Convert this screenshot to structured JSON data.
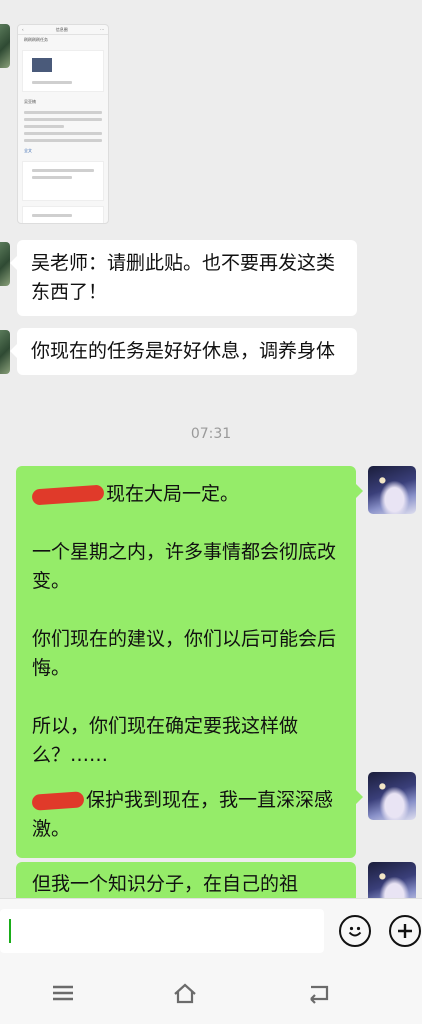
{
  "top_title": "",
  "screenshot_preview": {
    "header": "信息圈",
    "lines": [
      "刷刷刷刷任务",
      "吴亚楠",
      "全文"
    ]
  },
  "messages": {
    "m1": "吴老师：请删此贴。也不要再发这类东西了！",
    "m2": "你现在的任务是好好休息，调养身体",
    "timestamp": "07:31",
    "m3_p1": "现在大局一定。",
    "m3_p2": "一个星期之内，许多事情都会彻底改变。",
    "m3_p3": "你们现在的建议，你们以后可能会后悔。",
    "m3_p4": "所以，你们现在确定要我这样做么？……",
    "m4": "保护我到现在，我一直深深感激。",
    "m5": "但我一个知识分子，在自己的祖"
  },
  "composer": {
    "input_value": ""
  },
  "icons": {
    "emoji": "emoji-icon",
    "plus": "plus-icon",
    "menu": "menu-icon",
    "home": "home-icon",
    "back": "back-icon"
  },
  "colors": {
    "self_bubble": "#95ec69",
    "other_bubble": "#ffffff",
    "background": "#ededed"
  }
}
